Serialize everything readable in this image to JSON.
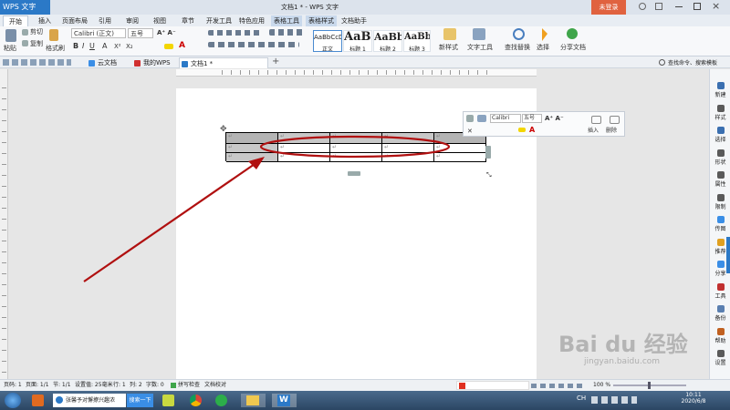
{
  "title_bar": {
    "app_button": "WPS 文字",
    "doc_title": "文档1 * - WPS 文字",
    "login_button": "未登录"
  },
  "menu_tabs": [
    "开始",
    "插入",
    "页面布局",
    "引用",
    "审阅",
    "视图",
    "章节",
    "开发工具",
    "特色应用",
    "表格工具",
    "表格样式",
    "文档助手"
  ],
  "ribbon": {
    "paste": "粘贴",
    "cut": "剪切",
    "copy": "复制",
    "format_painter": "格式刷",
    "font_name": "Calibri (正文)",
    "font_size": "五号",
    "styles": [
      {
        "preview": "AaBbCcDd",
        "label": "正文"
      },
      {
        "preview": "AaBl",
        "label": "标题 1"
      },
      {
        "preview": "AaBb(",
        "label": "标题 2"
      },
      {
        "preview": "AaBbC",
        "label": "标题 3"
      }
    ],
    "new_style": "新样式",
    "text_tools": "文字工具",
    "find_replace": "查找替换",
    "select": "选择",
    "share_doc": "分享文档"
  },
  "doc_tabs": [
    "云文档",
    "我的WPS",
    "文档1 *"
  ],
  "search_box": "查找命令、搜索模板",
  "mini_toolbar": {
    "font": "Calibri",
    "size": "五号",
    "insert": "插入",
    "delete": "删除"
  },
  "table": {
    "cell_mark": "↵",
    "row_count": 3,
    "col_count": 5
  },
  "right_sidebar": [
    "新建",
    "样式",
    "选择",
    "形状",
    "属性",
    "限制",
    "传图",
    "推荐",
    "分享",
    "工具",
    "备份",
    "帮助",
    "设置"
  ],
  "status_bar": {
    "page": "页码: 1",
    "pages": "页面: 1/1",
    "section": "节: 1/1",
    "position": "设置值: 25毫米",
    "row": "行: 1",
    "col": "列: 2",
    "words": "字数: 0",
    "spell": "拼写检查",
    "proof": "文档校对",
    "zoom": "100 %"
  },
  "taskbar": {
    "search_text": "张馨予对懈撩兴趣浓",
    "search_button": "搜索一下",
    "tray_label": "CH",
    "time": "10:11",
    "date": "2020/6/8"
  },
  "watermark": {
    "brand": "Bai du 经验",
    "url": "jingyan.baidu.com"
  },
  "colors": {
    "accent": "#2b79c7",
    "annotation_red": "#b01010",
    "header_cell": "#b4b4b4",
    "login": "#e0623f"
  }
}
